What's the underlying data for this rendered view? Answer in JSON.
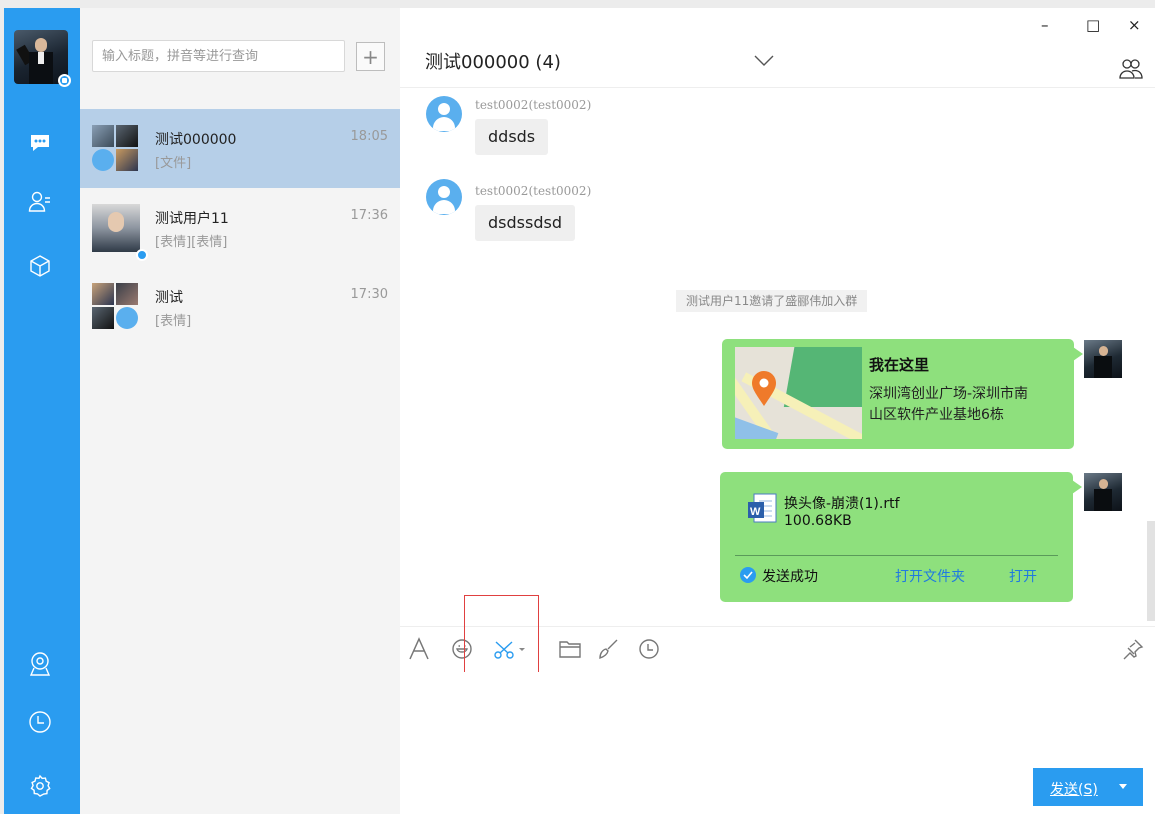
{
  "window": {
    "minimize": "–",
    "maximize": "□",
    "close": "×"
  },
  "search": {
    "placeholder": "输入标题，拼音等进行查询",
    "add_label": "+"
  },
  "sessions": [
    {
      "name": "测试000000",
      "time": "18:05",
      "preview": "[文件]"
    },
    {
      "name": "测试用户11",
      "time": "17:36",
      "preview": "[表情][表情]"
    },
    {
      "name": "测试",
      "time": "17:30",
      "preview": "[表情]"
    }
  ],
  "chat": {
    "title": "测试000000 (4)",
    "messages": [
      {
        "sender": "test0002(test0002)",
        "text": "ddsds"
      },
      {
        "sender": "test0002(test0002)",
        "text": "dsdssdsd"
      }
    ],
    "system_notice": "测试用户11邀请了盛郦伟加入群",
    "location": {
      "title": "我在这里",
      "address_line1": "深圳湾创业广场-深圳市南",
      "address_line2": "山区软件产业基地6栋"
    },
    "file": {
      "name": "换头像-崩溃(1).rtf",
      "size": "100.68KB",
      "status": "发送成功",
      "open_folder": "打开文件夹",
      "open": "打开"
    }
  },
  "composer": {
    "send_label": "发送(S)"
  },
  "icons": {
    "nav": [
      "chat-icon",
      "contacts-icon",
      "apps-cube-icon",
      "webcam-icon",
      "clock-icon",
      "settings-icon"
    ],
    "toolbar": [
      "font-icon",
      "emoji-icon",
      "scissors-icon",
      "folder-icon",
      "brush-icon",
      "history-icon",
      "pin-icon"
    ]
  },
  "colors": {
    "accent": "#2a9cf0",
    "selected": "#b6cfe8",
    "my_bubble": "#8ee07d",
    "highlight_box": "#e04040"
  }
}
